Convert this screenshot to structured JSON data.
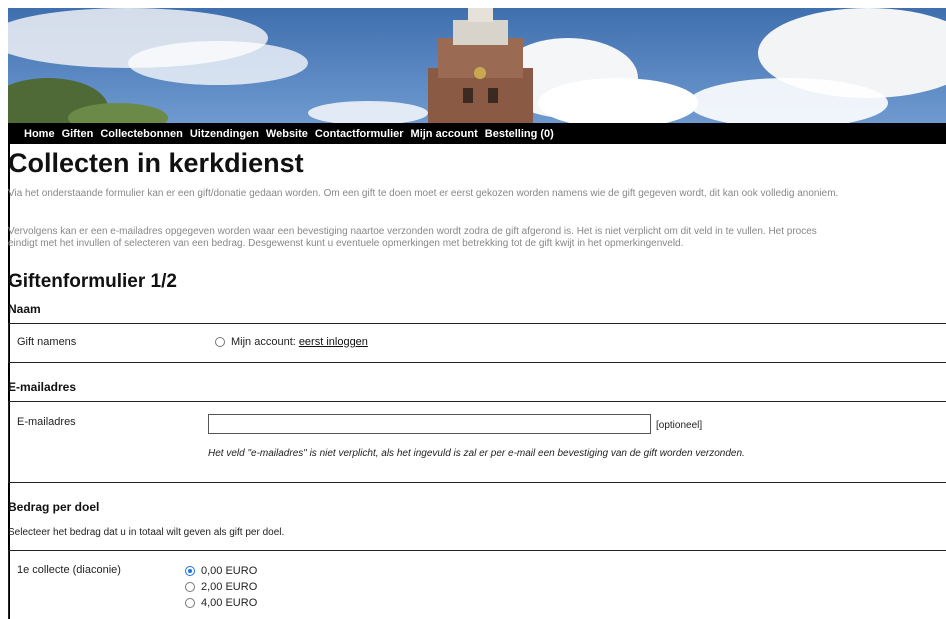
{
  "nav": {
    "items": [
      "Home",
      "Giften",
      "Collectebonnen",
      "Uitzendingen",
      "Website",
      "Contactformulier",
      "Mijn account",
      "Bestelling (0)"
    ]
  },
  "page": {
    "title": "Collecten in kerkdienst",
    "intro1": "Via het onderstaande formulier kan er een gift/donatie gedaan worden. Om een gift te doen moet er eerst gekozen worden namens wie de gift gegeven wordt, dit kan ook volledig anoniem.",
    "intro2_line1": "Vervolgens kan er een e-mailadres opgegeven worden waar een bevestiging naartoe verzonden wordt zodra de gift afgerond is. Het is niet verplicht om dit veld in te vullen. Het proces",
    "intro2_line2": "eindigt met het invullen of selecteren van een bedrag. Desgewenst kunt u eventuele opmerkingen met betrekking tot de gift kwijt in het opmerkingenveld."
  },
  "form": {
    "title": "Giftenformulier 1/2",
    "naam": {
      "heading": "Naam",
      "label": "Gift namens",
      "option_label": "Mijn account:",
      "option_link": "eerst inloggen"
    },
    "email": {
      "heading": "E-mailadres",
      "label": "E-mailadres",
      "value": "",
      "optional": "[optioneel]",
      "hint": "Het veld \"e-mailadres\" is niet verplicht, als het ingevuld is zal er per e-mail een bevestiging van de gift worden verzonden."
    },
    "bedrag": {
      "heading": "Bedrag per doel",
      "note": "Selecteer het bedrag dat u in totaal wilt geven als gift per doel.",
      "doel_label": "1e collecte (diaconie)",
      "options": [
        "0,00 EURO",
        "2,00 EURO",
        "4,00 EURO"
      ],
      "selected_index": 0
    }
  }
}
